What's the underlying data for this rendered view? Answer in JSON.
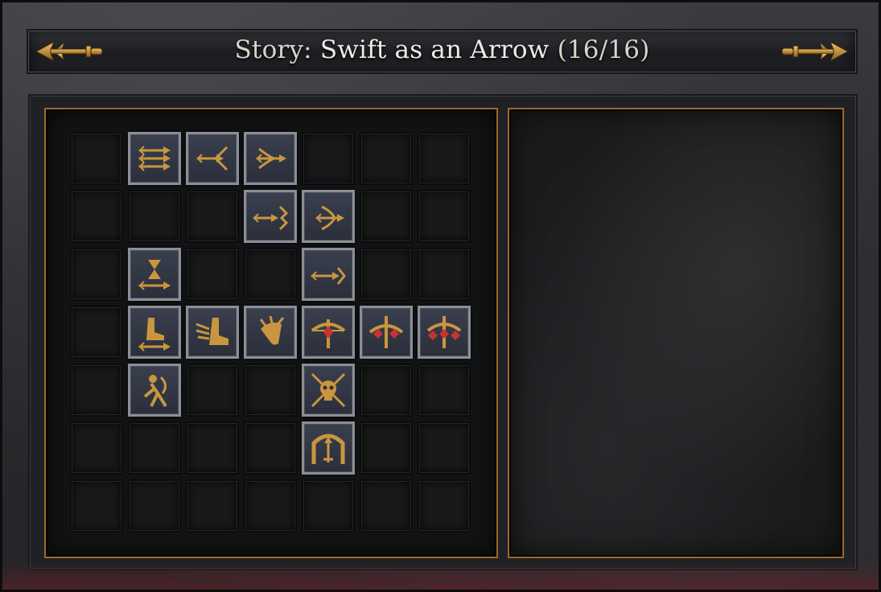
{
  "title": {
    "prefix": "Story:",
    "name": "Swift as an Arrow",
    "progress": "(16/16)"
  },
  "navigation": {
    "prev_icon": "left-arrow-icon",
    "next_icon": "right-arrow-icon"
  },
  "colors": {
    "gold": "#c9963f",
    "red": "#c8332c",
    "frame": "#8b8e96"
  },
  "grid": {
    "columns": 7,
    "rows": 7,
    "skills": [
      {
        "row": 0,
        "col": 1,
        "icon": "triple-arrow-icon"
      },
      {
        "row": 0,
        "col": 2,
        "icon": "split-arrow-icon"
      },
      {
        "row": 0,
        "col": 3,
        "icon": "fletched-arrow-icon"
      },
      {
        "row": 1,
        "col": 3,
        "icon": "piercing-arrow-icon"
      },
      {
        "row": 1,
        "col": 4,
        "icon": "deflect-arrow-icon"
      },
      {
        "row": 2,
        "col": 1,
        "icon": "hourglass-arrow-icon"
      },
      {
        "row": 2,
        "col": 4,
        "icon": "feathered-arrow-icon"
      },
      {
        "row": 3,
        "col": 1,
        "icon": "boot-arrow-icon"
      },
      {
        "row": 3,
        "col": 2,
        "icon": "winged-boot-icon"
      },
      {
        "row": 3,
        "col": 3,
        "icon": "quiver-icon"
      },
      {
        "row": 3,
        "col": 4,
        "icon": "crossbow-icon"
      },
      {
        "row": 3,
        "col": 5,
        "icon": "crossbow-gems-icon"
      },
      {
        "row": 3,
        "col": 6,
        "icon": "crossbow-triple-gems-icon"
      },
      {
        "row": 4,
        "col": 1,
        "icon": "archer-icon"
      },
      {
        "row": 4,
        "col": 4,
        "icon": "skull-crossed-arrows-icon"
      },
      {
        "row": 5,
        "col": 4,
        "icon": "arrow-gate-icon"
      }
    ]
  }
}
